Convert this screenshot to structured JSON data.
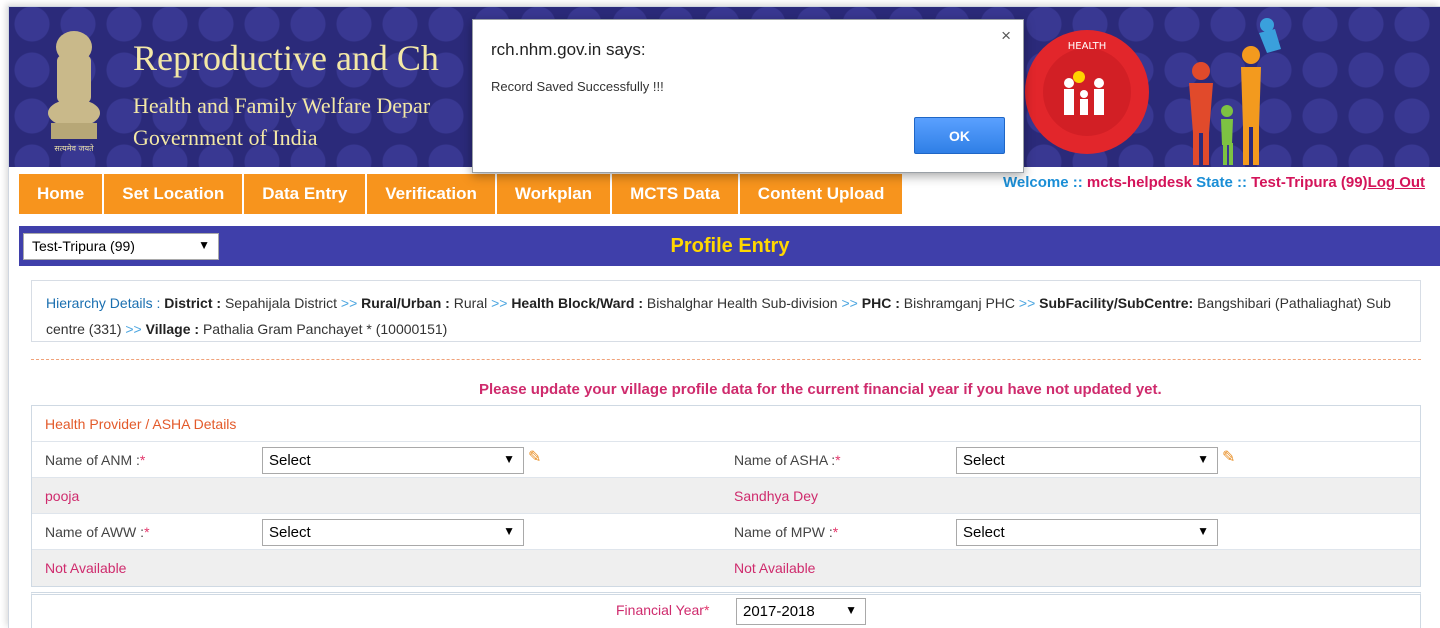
{
  "header": {
    "title": "Reproductive and Ch",
    "subtitle1": "Health and Family Welfare Depar",
    "subtitle2": "Government of India",
    "emblem_icon": "national-emblem-icon",
    "nhm_logo": "national-health-mission-logo"
  },
  "nav": {
    "items": [
      "Home",
      "Set Location",
      "Data Entry",
      "Verification",
      "Workplan",
      "MCTS Data",
      "Content Upload"
    ]
  },
  "welcome": {
    "welcome_label": "Welcome :: ",
    "user": "mcts-helpdesk",
    "state_label": " State :: ",
    "state": "Test-Tripura (99)",
    "logout": "Log Out"
  },
  "profile": {
    "state_select": "Test-Tripura (99)",
    "title": "Profile Entry"
  },
  "hierarchy": {
    "heading": "Hierarchy Details : ",
    "district_label": "District :",
    "district": " Sepahijala District ",
    "ru_label": "Rural/Urban :",
    "ru": " Rural ",
    "block_label": "Health Block/Ward :",
    "block": " Bishalghar Health Sub-division ",
    "phc_label": "PHC :",
    "phc": " Bishramganj PHC ",
    "sub_label": "SubFacility/SubCentre:",
    "sub": " Bangshibari (Pathaliaghat) Sub centre (331) ",
    "village_label": "Village :",
    "village": " Pathalia Gram Panchayet * (10000151)",
    "sep": ">>"
  },
  "notice": "Please update your village profile data for the current financial year if you have not updated yet.",
  "form": {
    "section_title": "Health Provider / ASHA Details",
    "anm_label": "Name of ANM : ",
    "asha_label": "Name of ASHA : ",
    "aww_label": "Name of AWW : ",
    "mpw_label": "Name of MPW : ",
    "required_mark": "*",
    "select_value": "Select",
    "anm_name": "pooja",
    "asha_name": "Sandhya Dey",
    "aww_name": "Not Available",
    "mpw_name": "Not Available",
    "fy_label": "Financial Year",
    "fy_value": "2017-2018"
  },
  "dialog": {
    "title": "rch.nhm.gov.in says:",
    "message": "Record Saved Successfully !!!",
    "ok": "OK",
    "close": "×"
  }
}
